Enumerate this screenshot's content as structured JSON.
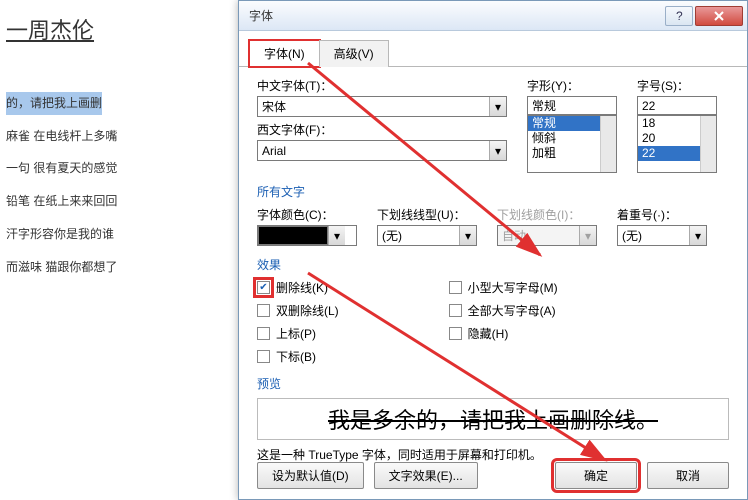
{
  "document": {
    "title_line": "一周杰伦",
    "selected_line": "的，请把我上画删",
    "lines": [
      "麻雀 在电线杆上多嘴",
      "一句 很有夏天的感觉",
      "铅笔 在纸上来来回回",
      "汗字形容你是我的谁",
      "而滋味 猫跟你都想了"
    ]
  },
  "dialog": {
    "title": "字体",
    "tabs": {
      "font": "字体(N)",
      "advanced": "高级(V)"
    },
    "labels": {
      "chinese_font": "中文字体(T)：",
      "western_font": "西文字体(F)：",
      "style": "字形(Y)：",
      "size": "字号(S)：",
      "all_text": "所有文字",
      "font_color": "字体颜色(C)：",
      "underline": "下划线线型(U)：",
      "underline_color": "下划线颜色(I)：",
      "emphasis": "着重号(·)：",
      "effects": "效果",
      "preview": "预览"
    },
    "values": {
      "chinese_font": "宋体",
      "western_font": "Arial",
      "style": "常规",
      "size": "22",
      "underline": "(无)",
      "underline_color": "自动",
      "emphasis": "(无)"
    },
    "style_list": [
      "常规",
      "倾斜",
      "加粗"
    ],
    "size_list": [
      "18",
      "20",
      "22"
    ],
    "effects": {
      "strikethrough": "删除线(K)",
      "double_strike": "双删除线(L)",
      "superscript": "上标(P)",
      "subscript": "下标(B)",
      "small_caps": "小型大写字母(M)",
      "all_caps": "全部大写字母(A)",
      "hidden": "隐藏(H)"
    },
    "preview_text": "我是多余的，请把我上画删除线。",
    "note": "这是一种 TrueType 字体，同时适用于屏幕和打印机。",
    "buttons": {
      "default": "设为默认值(D)",
      "text_effects": "文字效果(E)...",
      "ok": "确定",
      "cancel": "取消"
    }
  }
}
